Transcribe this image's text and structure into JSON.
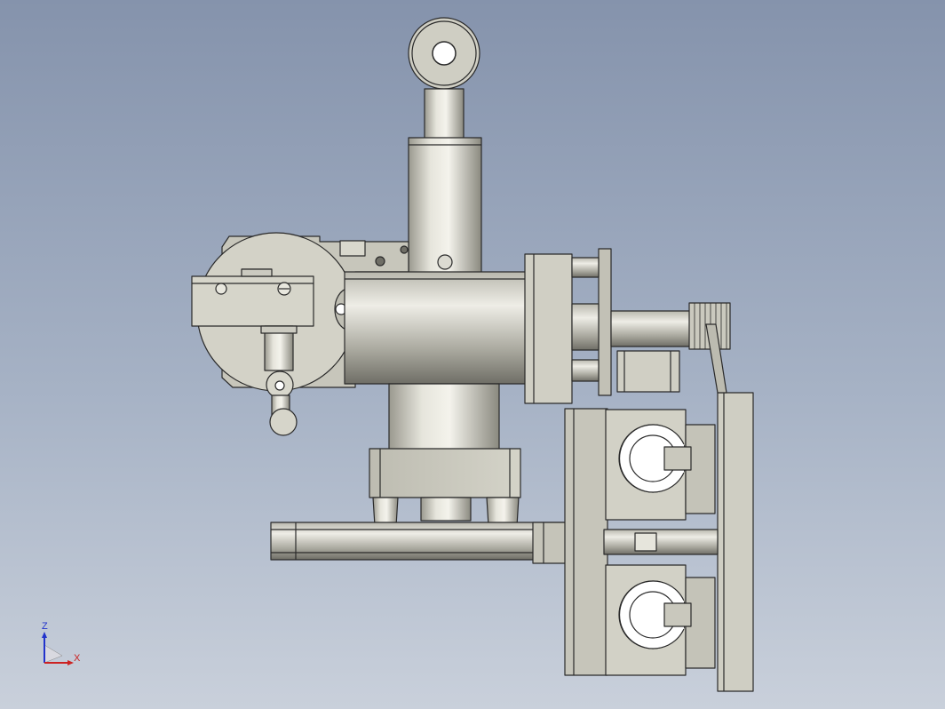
{
  "viewport": {
    "background_top": "#8593ac",
    "background_bottom": "#c9d0db"
  },
  "model": {
    "part_fill": "#c9c8bc",
    "part_dark": "#8f8e84",
    "outline": "#2a2a2a"
  },
  "triad": {
    "z_label": "Z",
    "x_label": "X",
    "z_color": "#2233cc",
    "x_color": "#cc2222"
  }
}
